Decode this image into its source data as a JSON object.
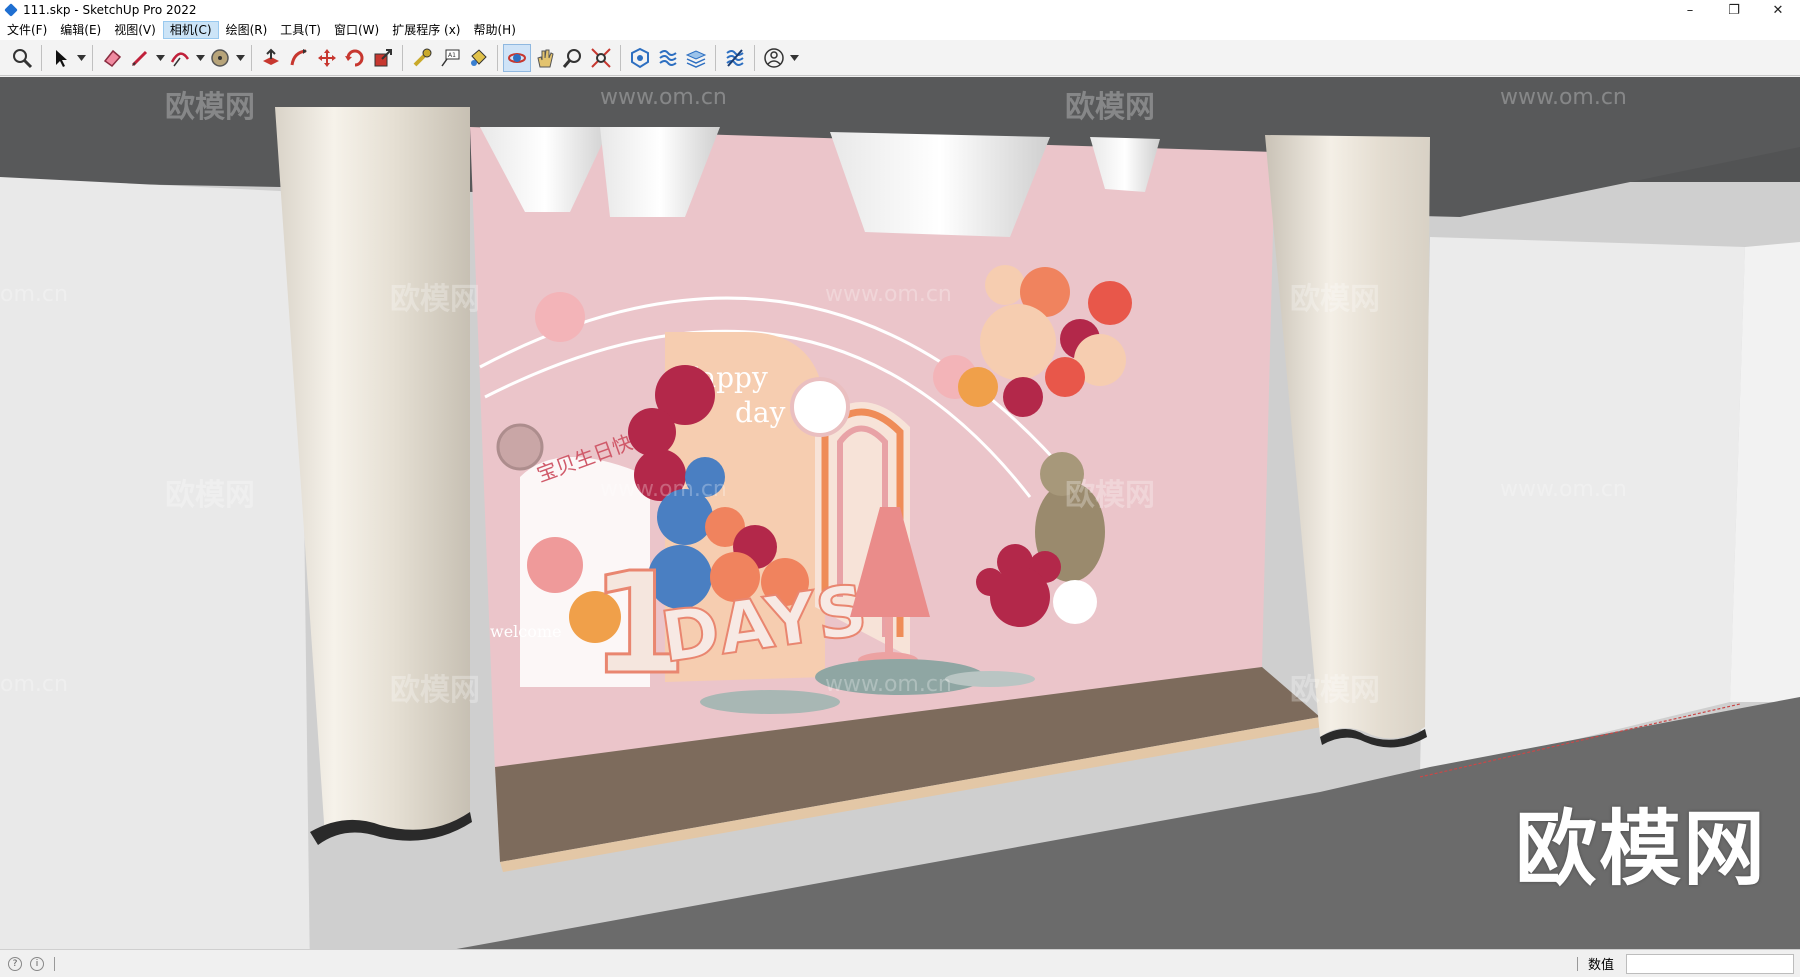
{
  "window": {
    "title": "111.skp - SketchUp Pro 2022",
    "min_glyph": "–",
    "max_glyph": "❐",
    "close_glyph": "✕"
  },
  "menu": [
    "文件(F)",
    "编辑(E)",
    "视图(V)",
    "相机(C)",
    "绘图(R)",
    "工具(T)",
    "窗口(W)",
    "扩展程序 (x)",
    "帮助(H)"
  ],
  "active_menu_index": 3,
  "toolbar": {
    "tools": [
      "zoom-extents",
      "select",
      "eraser",
      "line",
      "arc",
      "shape",
      "push-pull",
      "follow-me",
      "move",
      "rotate",
      "scale",
      "tape-measure",
      "text",
      "paint-bucket",
      "orbit",
      "pan",
      "zoom",
      "zoom-window",
      "components",
      "materials",
      "layers",
      "styles",
      "account"
    ],
    "selected_tool": "orbit"
  },
  "scene": {
    "arch_text_1": "Happy",
    "arch_text_2": "day",
    "days_text": "DAYS",
    "number_text": "1",
    "welcome_text": "welcome",
    "arch_banner": "宝贝生日快乐",
    "colors": {
      "wall": "#e8c4c8",
      "floor": "#7a6a5d",
      "curtain": "#f1ece3",
      "peach": "#f6cdb0"
    }
  },
  "watermarks": {
    "cn": "欧模网",
    "url": "www.om.cn",
    "short": "om.cn"
  },
  "brand_overlay": "欧模网",
  "status": {
    "measure_label": "数值",
    "measure_value": "",
    "info1": "?",
    "info2": "i"
  }
}
